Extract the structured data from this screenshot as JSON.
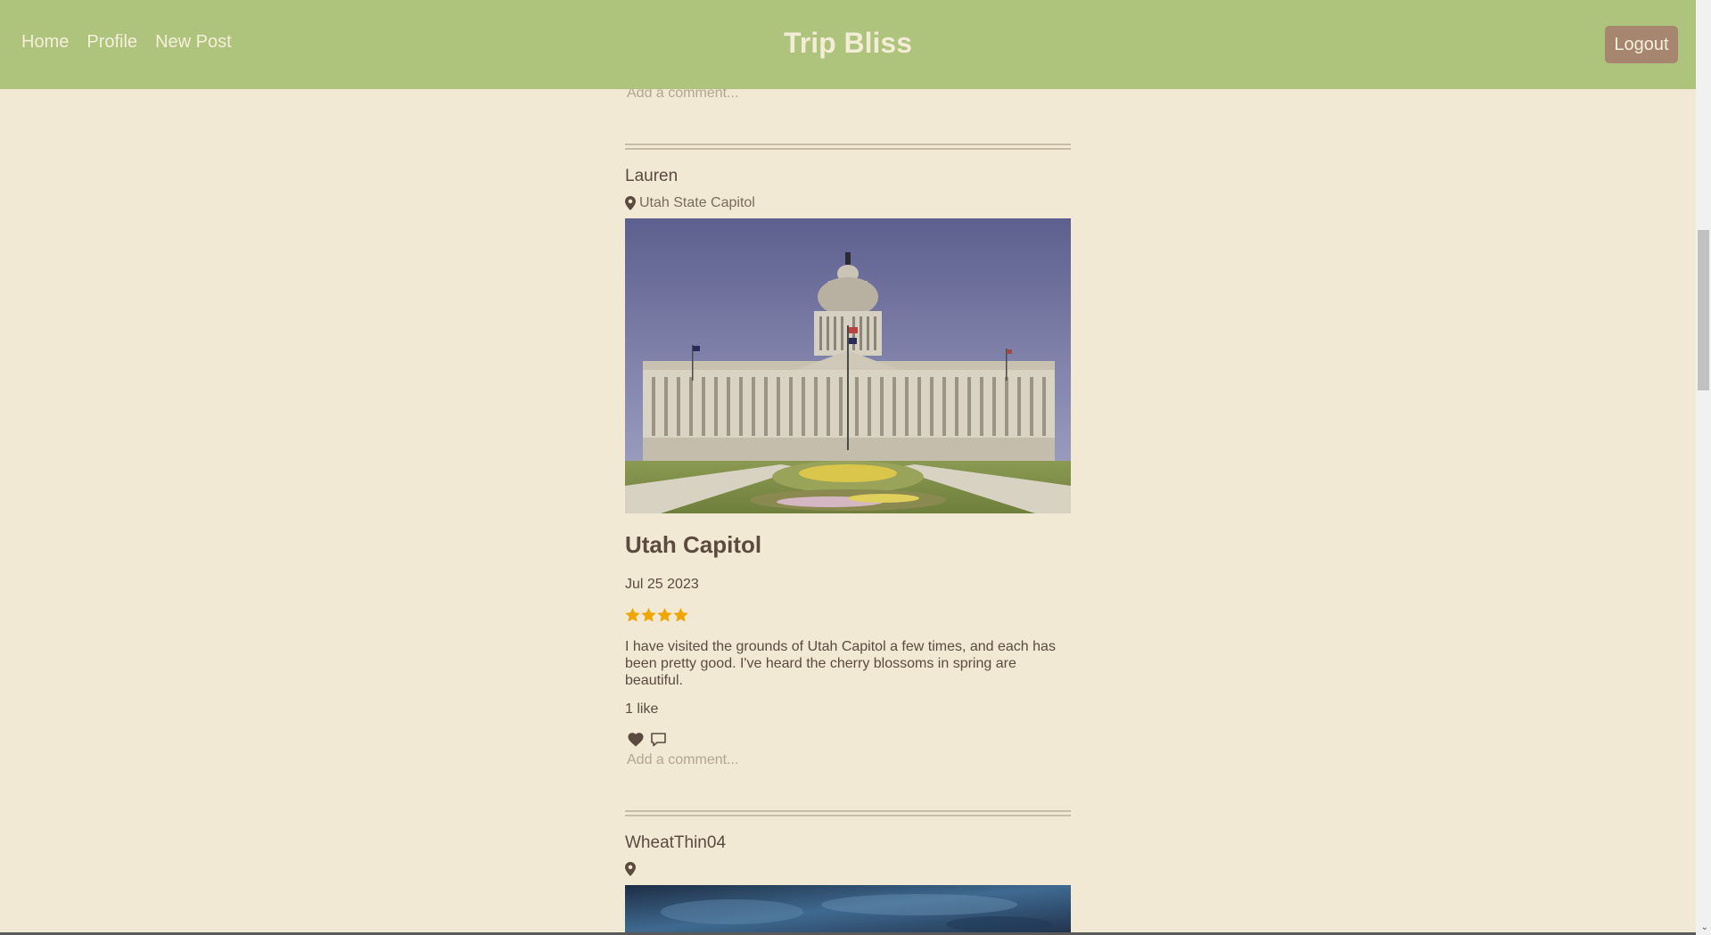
{
  "nav": {
    "links": [
      "Home",
      "Profile",
      "New Post"
    ],
    "brand": "Trip Bliss",
    "logout": "Logout"
  },
  "comment_placeholder": "Add a comment...",
  "posts": [
    {
      "username": "Lauren",
      "location": "Utah State Capitol",
      "title": "Utah Capitol",
      "date": "Jul 25 2023",
      "rating": 4,
      "body": "I have visited the grounds of Utah Capitol a few times, and each has been pretty good. I've heard the cherry blossoms in spring are beautiful.",
      "likes": "1 like"
    },
    {
      "username": "WheatThin04",
      "location": ""
    }
  ],
  "colors": {
    "navbar": "#aec37c",
    "background": "#f1e9d3",
    "logout": "#a7866f",
    "star": "#f0a500",
    "text": "#5a4a3f"
  },
  "icons": [
    "map-pin-icon",
    "heart-icon",
    "comment-icon",
    "star-icon"
  ]
}
